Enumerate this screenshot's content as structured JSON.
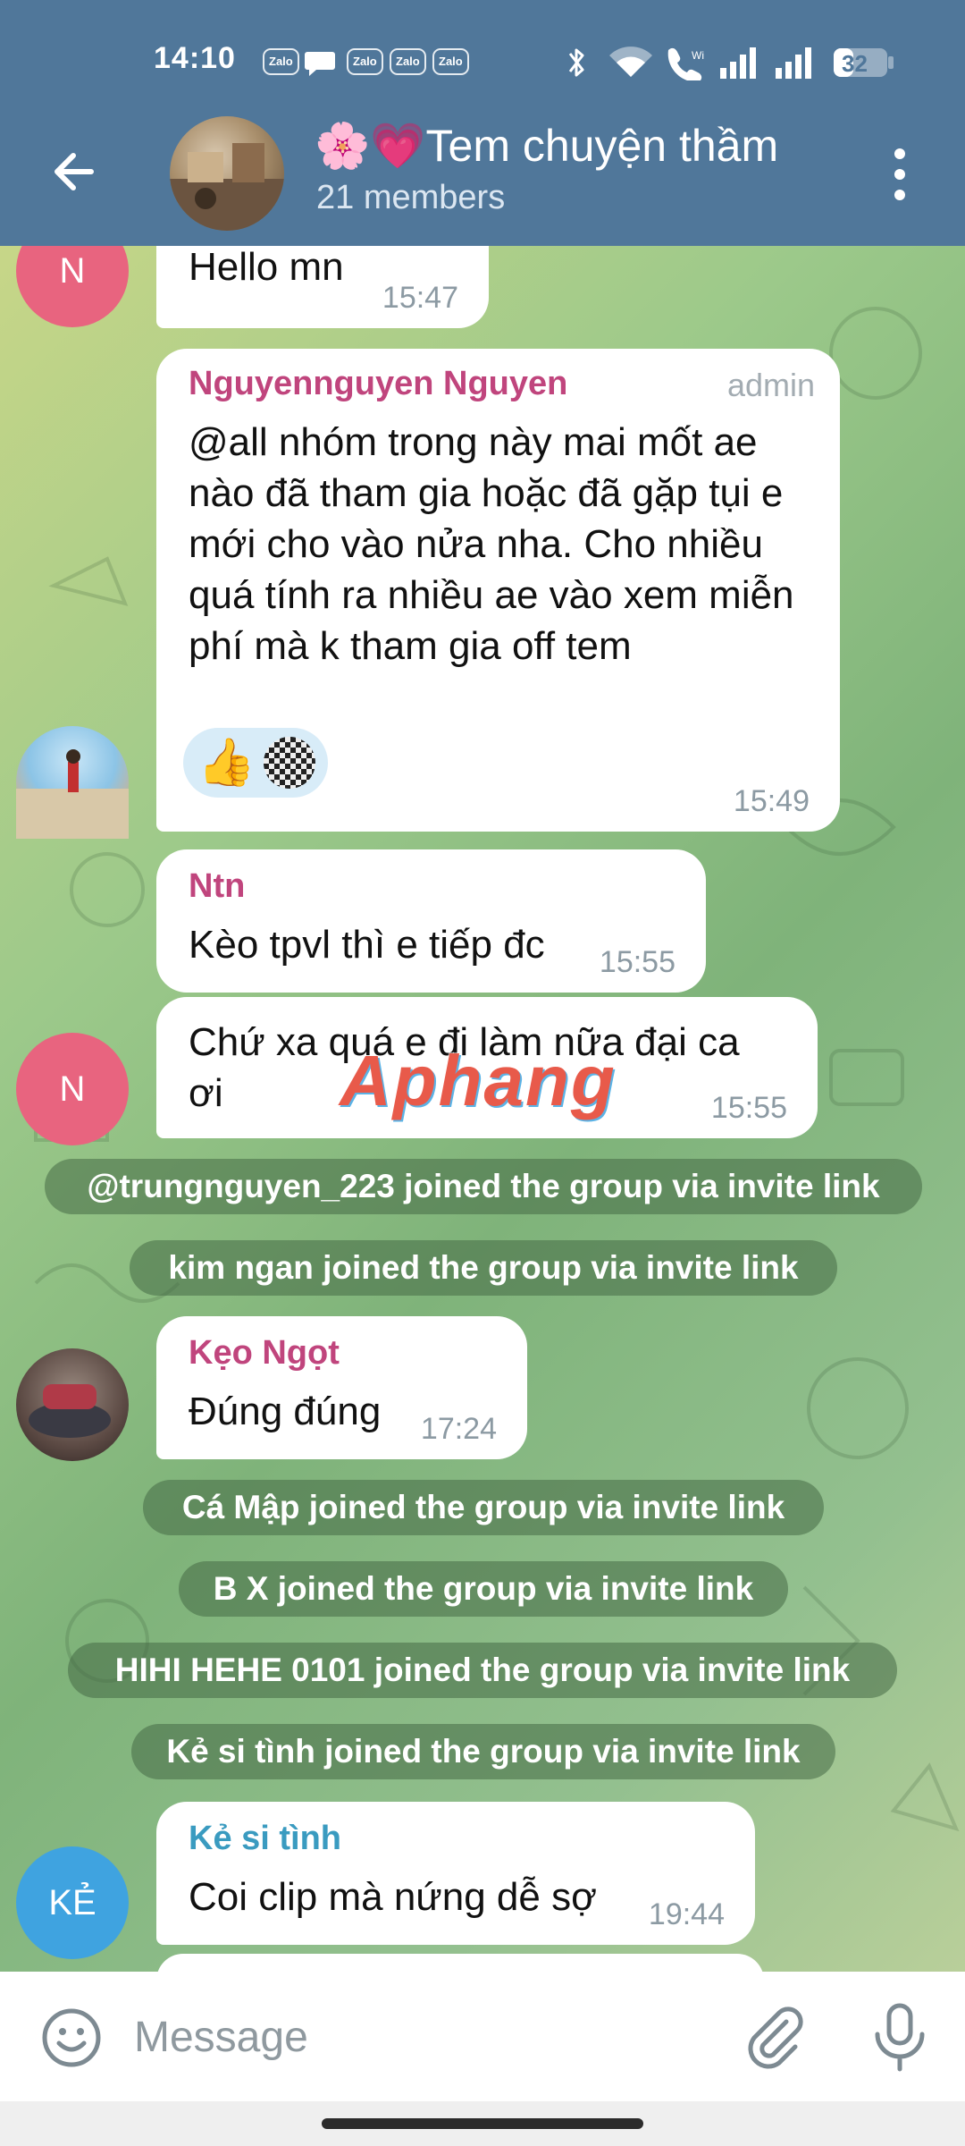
{
  "status": {
    "time": "14:10",
    "app_badges": [
      "Zalo",
      "Zalo",
      "Zalo",
      "Zalo"
    ],
    "battery": "32",
    "icons": [
      "zalo-icon",
      "chat-bubble-icon",
      "bluetooth-icon",
      "wifi-icon",
      "call-icon",
      "signal-icon",
      "battery-icon"
    ]
  },
  "header": {
    "title": "🌸💗Tem chuyện thầm",
    "subtitle": "21 members",
    "icons": [
      "back-arrow-icon",
      "more-vertical-icon"
    ]
  },
  "messages": [
    {
      "avatar_initial": "N",
      "text": "Hello mn",
      "time": "15:47",
      "avatar_color": "#e8647f"
    },
    {
      "sender": "Nguyennguyen Nguyen",
      "role": "admin",
      "text": "@all nhóm trong này mai mốt ae nào đã tham gia hoặc đã gặp tụi e mới cho vào nửa nha. Cho nhiều quá tính ra nhiều ae vào xem miễn phí mà k tham gia off tem",
      "time": "15:49",
      "sender_color": "#c0457d",
      "reactions": [
        "👍"
      ]
    },
    {
      "sender": "Ntn",
      "text": "Kèo tpvl thì e tiếp đc",
      "time": "15:55",
      "sender_color": "#c0457d"
    },
    {
      "avatar_initial": "N",
      "text": "Chứ xa quá e đi làm nữa đại ca ơi",
      "time": "15:55",
      "avatar_color": "#e8647f"
    },
    {
      "sender": "Kẹo Ngọt",
      "text": "Đúng đúng",
      "time": "17:24",
      "sender_color": "#c0457d"
    },
    {
      "sender": "Kẻ si tình",
      "avatar_initial": "KẺ",
      "text": "Coi clip mà nứng dễ sợ",
      "time": "19:44",
      "sender_color": "#3a9bc0",
      "avatar_color": "#3fa3e0"
    }
  ],
  "service_messages": [
    "@trungnguyen_223 joined the group via invite link",
    "kim ngan joined the group via invite link",
    "Cá Mập joined the group via invite link",
    "B X joined the group via invite link",
    "HIHI HEHE 0101 joined the group via invite link",
    "Kẻ si tình joined the group via invite link"
  ],
  "watermark": "Aphang",
  "input": {
    "placeholder": "Message",
    "icons": [
      "emoji-icon",
      "attach-icon",
      "microphone-icon"
    ]
  },
  "colors": {
    "header_bg": "#50779a",
    "accent_pink": "#c0457d",
    "accent_blue": "#3a9bc0"
  }
}
